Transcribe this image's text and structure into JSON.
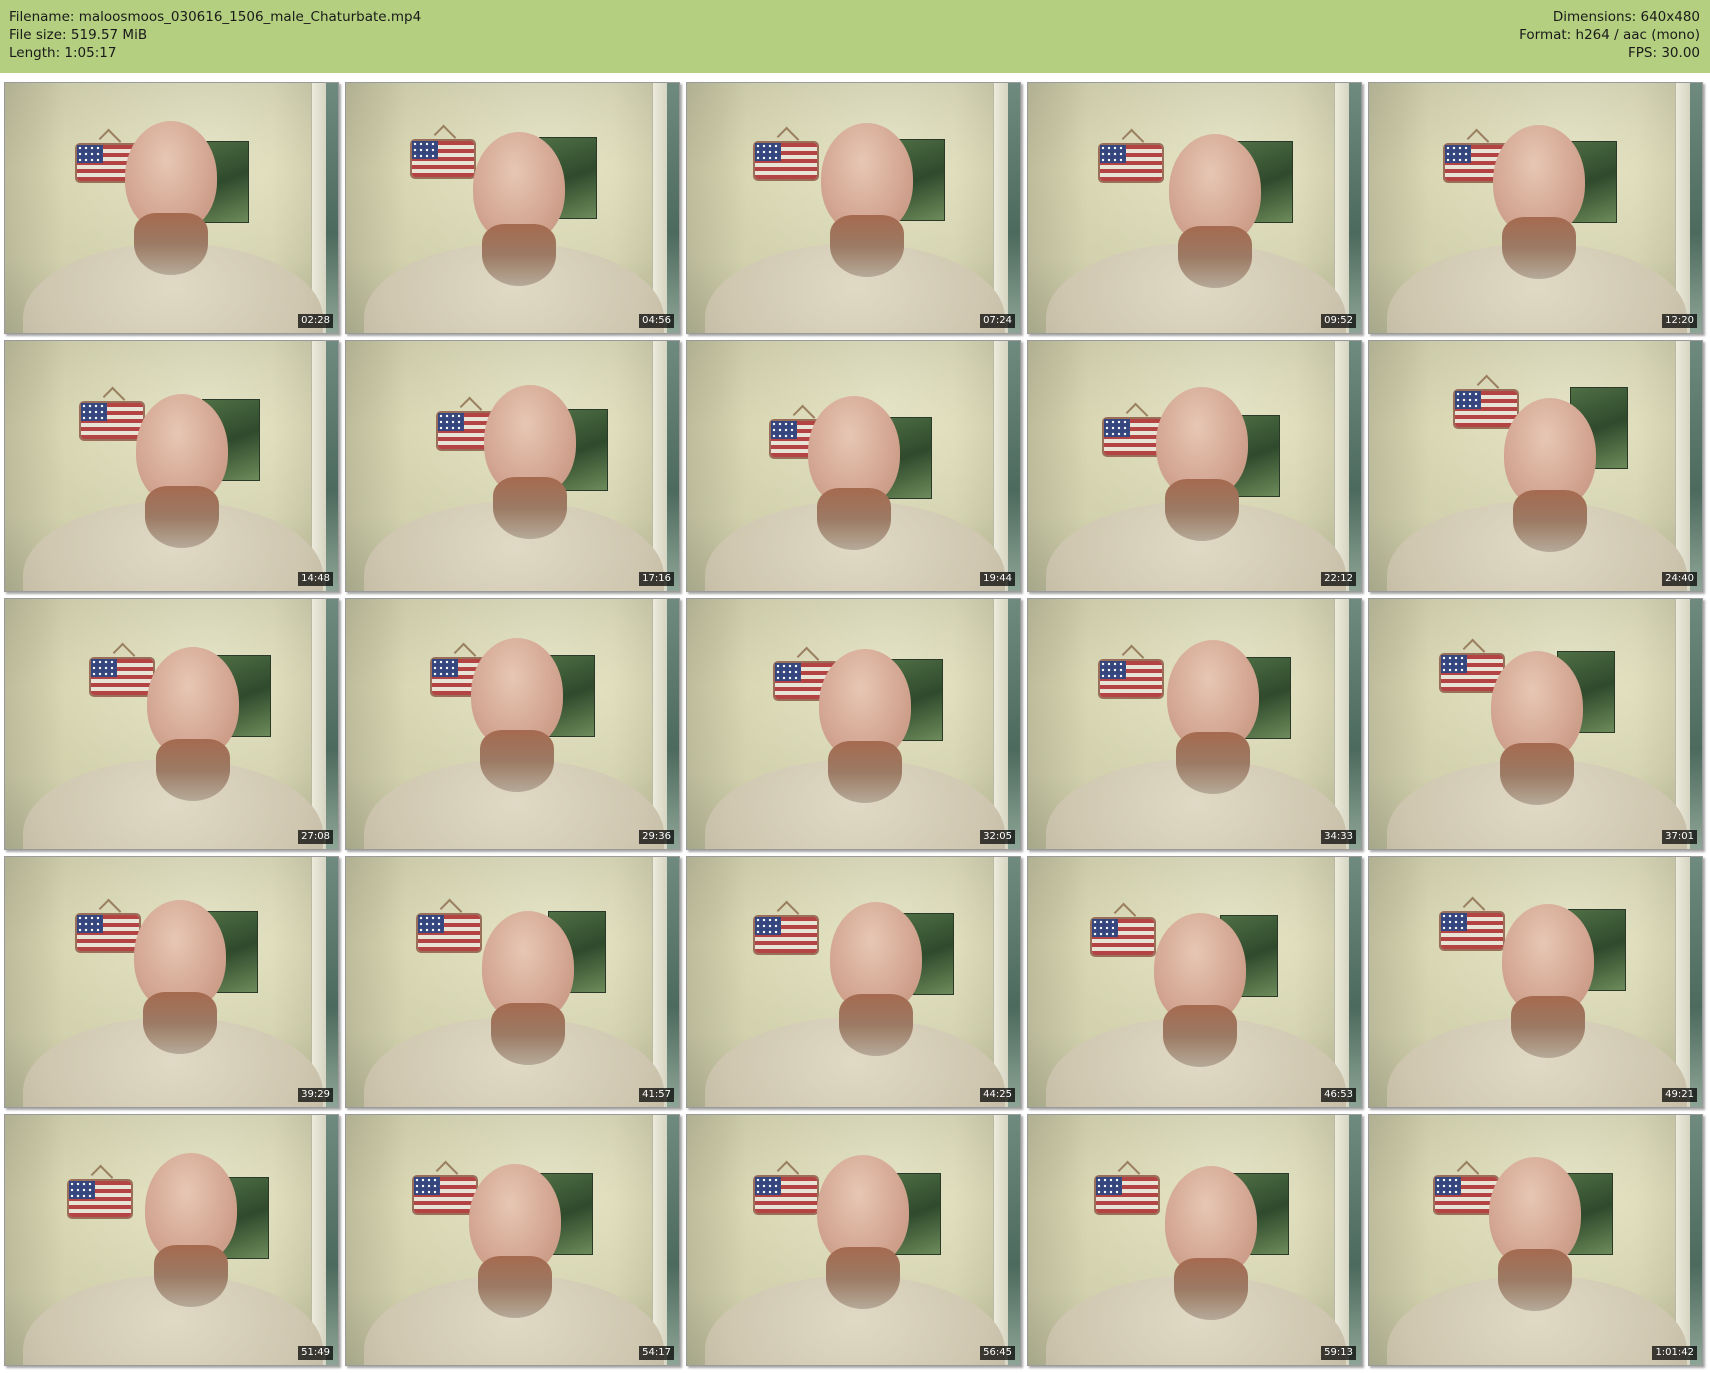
{
  "header": {
    "left": [
      "Filename: maloosmoos_030616_1506_male_Chaturbate.mp4",
      "File size: 519.57 MiB",
      "Length: 1:05:17"
    ],
    "right": [
      "Dimensions: 640x480",
      "Format: h264 / aac (mono)",
      "FPS: 30.00"
    ],
    "background_color": "#b3cf7f"
  },
  "thumbnails": [
    {
      "time": "02:28"
    },
    {
      "time": "04:56"
    },
    {
      "time": "07:24"
    },
    {
      "time": "09:52"
    },
    {
      "time": "12:20"
    },
    {
      "time": "14:48"
    },
    {
      "time": "17:16"
    },
    {
      "time": "19:44"
    },
    {
      "time": "22:12"
    },
    {
      "time": "24:40"
    },
    {
      "time": "27:08"
    },
    {
      "time": "29:36"
    },
    {
      "time": "32:05"
    },
    {
      "time": "34:33"
    },
    {
      "time": "37:01"
    },
    {
      "time": "39:29"
    },
    {
      "time": "41:57"
    },
    {
      "time": "44:25"
    },
    {
      "time": "46:53"
    },
    {
      "time": "49:21"
    },
    {
      "time": "51:49"
    },
    {
      "time": "54:17"
    },
    {
      "time": "56:45"
    },
    {
      "time": "59:13"
    },
    {
      "time": "1:01:42"
    }
  ]
}
